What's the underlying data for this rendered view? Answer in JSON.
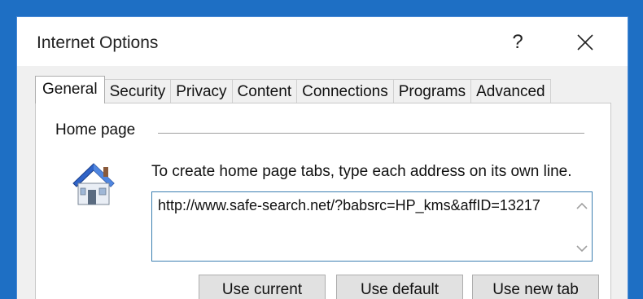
{
  "window": {
    "title": "Internet Options",
    "help_glyph": "?",
    "close_icon": "close-icon"
  },
  "tabs": [
    {
      "label": "General",
      "active": true
    },
    {
      "label": "Security",
      "active": false
    },
    {
      "label": "Privacy",
      "active": false
    },
    {
      "label": "Content",
      "active": false
    },
    {
      "label": "Connections",
      "active": false
    },
    {
      "label": "Programs",
      "active": false
    },
    {
      "label": "Advanced",
      "active": false
    }
  ],
  "home_page": {
    "group_label": "Home page",
    "icon": "house-icon",
    "instruction": "To create home page tabs, type each address on its own line.",
    "url_value": "http://www.safe-search.net/?babsrc=HP_kms&affID=13217"
  },
  "buttons": {
    "use_current": "Use current",
    "use_default": "Use default",
    "use_new_tab": "Use new tab"
  },
  "colors": {
    "desktop_bg": "#1e6fc4",
    "dialog_border": "#4a8ad6",
    "house_roof": "#2f63c8",
    "field_border": "#3c7fb1"
  }
}
